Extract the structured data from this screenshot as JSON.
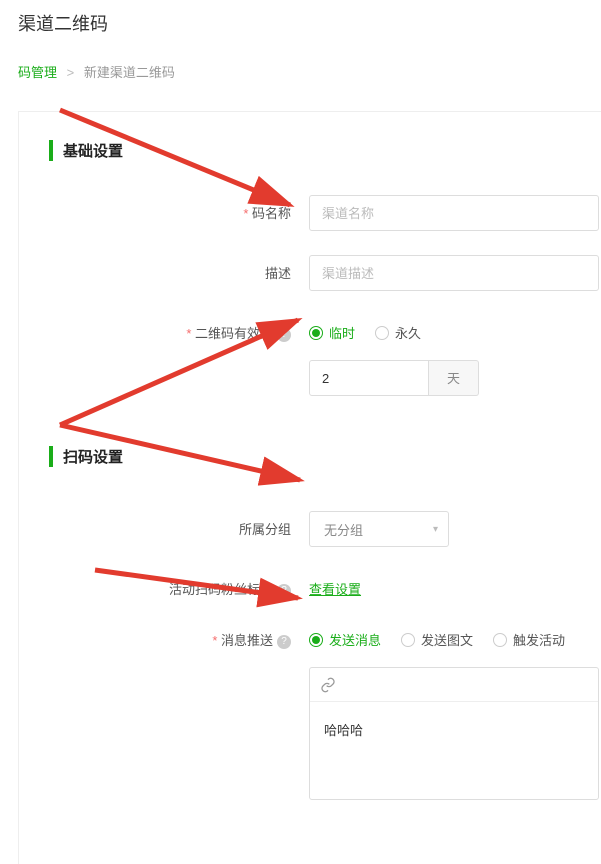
{
  "page_title": "渠道二维码",
  "breadcrumb": {
    "link": "码管理",
    "current": "新建渠道二维码"
  },
  "sections": {
    "basic": "基础设置",
    "scan": "扫码设置"
  },
  "fields": {
    "name": {
      "label": "码名称",
      "placeholder": "渠道名称"
    },
    "desc": {
      "label": "描述",
      "placeholder": "渠道描述"
    },
    "validity": {
      "label": "二维码有效期",
      "options": {
        "temp": "临时",
        "perm": "永久"
      },
      "duration_value": "2",
      "duration_unit": "天"
    },
    "group": {
      "label": "所属分组",
      "selected": "无分组"
    },
    "tags": {
      "label": "活动扫码粉丝标签",
      "link": "查看设置"
    },
    "push": {
      "label": "消息推送",
      "options": {
        "msg": "发送消息",
        "rich": "发送图文",
        "act": "触发活动"
      },
      "content": "哈哈哈"
    }
  }
}
